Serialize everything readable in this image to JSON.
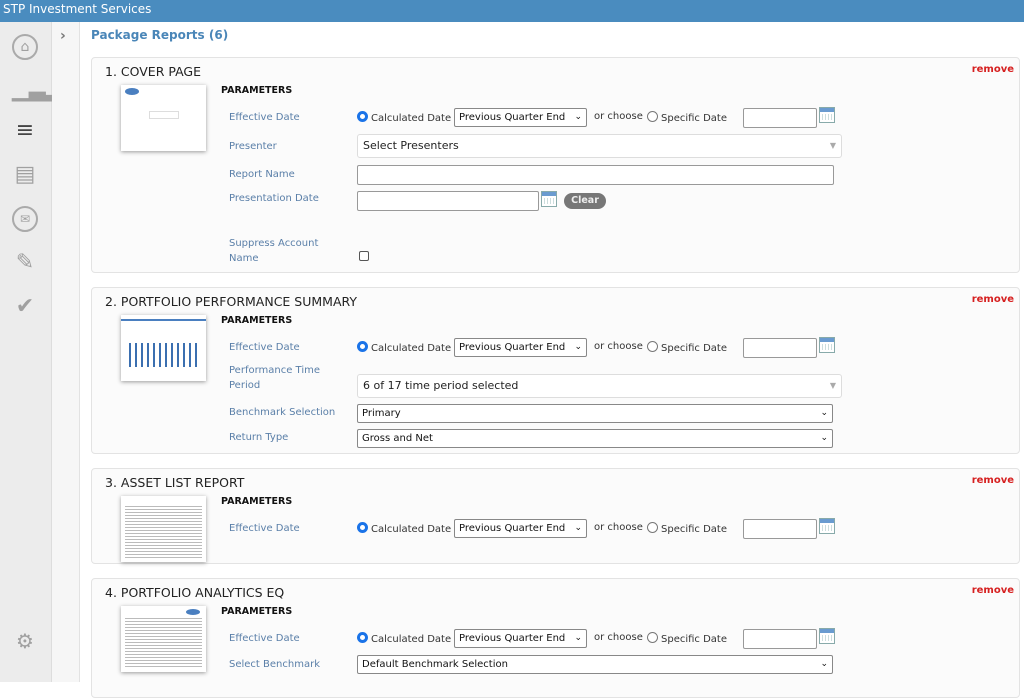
{
  "app": {
    "title": "STP Investment Services"
  },
  "sidebar": {
    "icons": [
      "home-icon",
      "bar-chart-icon",
      "menu-icon",
      "document-icon",
      "mail-list-icon",
      "edit-icon",
      "check-icon",
      "gear-icon"
    ]
  },
  "page": {
    "title": "Package Reports (6)"
  },
  "common": {
    "remove": "remove",
    "parameters": "PARAMETERS",
    "effective_date": "Effective Date",
    "calculated_date": "Calculated Date",
    "or_choose": "or choose",
    "specific_date": "Specific Date",
    "date_option": "Previous Quarter End"
  },
  "cards": [
    {
      "title": "1. COVER PAGE",
      "presenter_label": "Presenter",
      "presenter_value": "Select Presenters",
      "report_name_label": "Report Name",
      "presentation_date_label": "Presentation Date",
      "clear": "Clear",
      "suppress_label": "Suppress Account Name",
      "suppress_checked": false
    },
    {
      "title": "2. PORTFOLIO PERFORMANCE SUMMARY",
      "period_label": "Performance Time Period",
      "period_value": "6 of 17 time period selected",
      "benchmark_label": "Benchmark Selection",
      "benchmark_value": "Primary",
      "return_label": "Return Type",
      "return_value": "Gross and Net"
    },
    {
      "title": "3. ASSET LIST REPORT"
    },
    {
      "title": "4. PORTFOLIO ANALYTICS EQ",
      "benchmark_label": "Select Benchmark",
      "benchmark_value": "Default Benchmark Selection"
    }
  ]
}
